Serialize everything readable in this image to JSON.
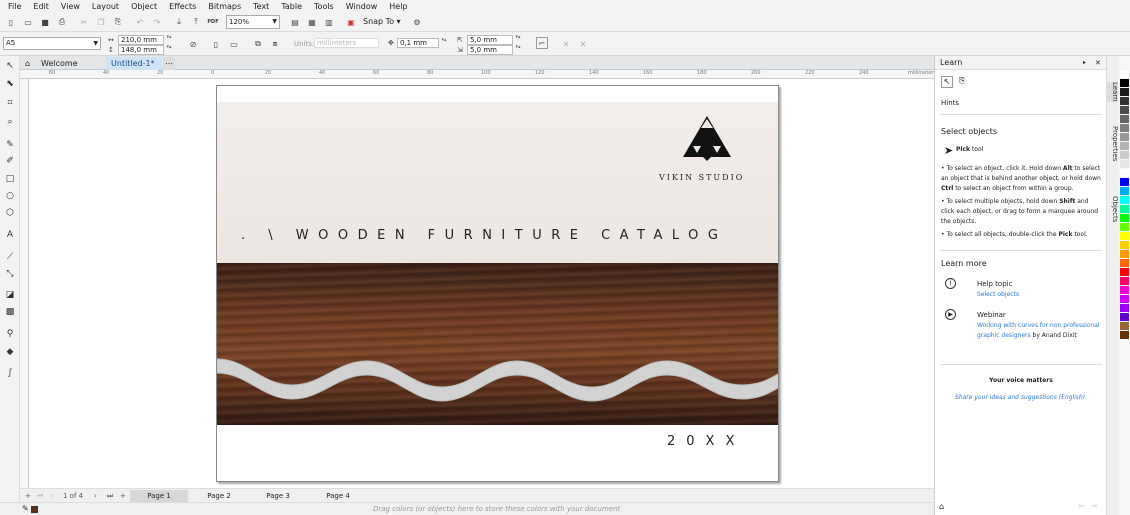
{
  "menu": [
    "File",
    "Edit",
    "View",
    "Layout",
    "Object",
    "Effects",
    "Bitmaps",
    "Text",
    "Table",
    "Tools",
    "Window",
    "Help"
  ],
  "toolbar": {
    "zoom": "120%",
    "snap_to": "Snap To",
    "pdf_label": "PDF"
  },
  "propbar": {
    "page_size": "A5",
    "width": "210,0 mm",
    "height": "148,0 mm",
    "units_label": "Units:",
    "units_value": "millimeters",
    "nudge": "0,1 mm",
    "dup_x": "5,0 mm",
    "dup_y": "5,0 mm"
  },
  "tabs": {
    "welcome": "Welcome Screen",
    "doc": "Untitled-1*"
  },
  "ruler": {
    "h": [
      "60",
      "40",
      "20",
      "0",
      "20",
      "40",
      "60",
      "80",
      "100",
      "120",
      "140",
      "160",
      "180",
      "200",
      "220",
      "240"
    ],
    "units": "millimeters"
  },
  "page_content": {
    "studio": "VIKIN STUDIO",
    "title": ". \\ WOODEN FURNITURE CATALOG",
    "year": "20XX"
  },
  "pagenav": {
    "counter": "1 of 4",
    "pages": [
      "Page 1",
      "Page 2",
      "Page 3",
      "Page 4"
    ]
  },
  "status": {
    "hint": "Drag colors (or objects) here to store these colors with your document"
  },
  "docker": {
    "title": "Learn",
    "hints_label": "Hints",
    "section_title": "Select objects",
    "tool_name": "Pick",
    "tool_suffix": "tool",
    "bullets": [
      [
        "To select an object, click it. Hold down ",
        "Alt",
        " to select an object that is behind another object, or hold down ",
        "Ctrl",
        " to select an object from within a group."
      ],
      [
        "To select multiple objects, hold down ",
        "Shift",
        " and click each object, or drag to form a marquee around the objects."
      ],
      [
        "To select all objects, double-click the ",
        "Pick",
        " tool."
      ]
    ],
    "learn_more": "Learn more",
    "help_topic": "Help topic",
    "help_link": "Select objects",
    "webinar": "Webinar",
    "webinar_link": "Working with curves for non professional graphic designers",
    "webinar_by": " by Anand Dixit",
    "voice_title": "Your voice matters",
    "voice_link": "Share your ideas and suggestions (English)."
  },
  "sidetabs": [
    "Learn",
    "Properties",
    "Objects"
  ],
  "palette": [
    "#ffffff",
    "#000000",
    "#1a1a1a",
    "#333333",
    "#4d4d4d",
    "#666666",
    "#808080",
    "#999999",
    "#b3b3b3",
    "#cccccc",
    "#e6e6e6",
    "#ffffff",
    "#0000ff",
    "#00aaff",
    "#00ffff",
    "#00ff99",
    "#00ff00",
    "#66ff00",
    "#ffff00",
    "#ffcc00",
    "#ff9900",
    "#ff6600",
    "#ff0000",
    "#ff0066",
    "#ff00cc",
    "#cc00ff",
    "#9900ff",
    "#6600cc",
    "#996633",
    "#663300"
  ]
}
